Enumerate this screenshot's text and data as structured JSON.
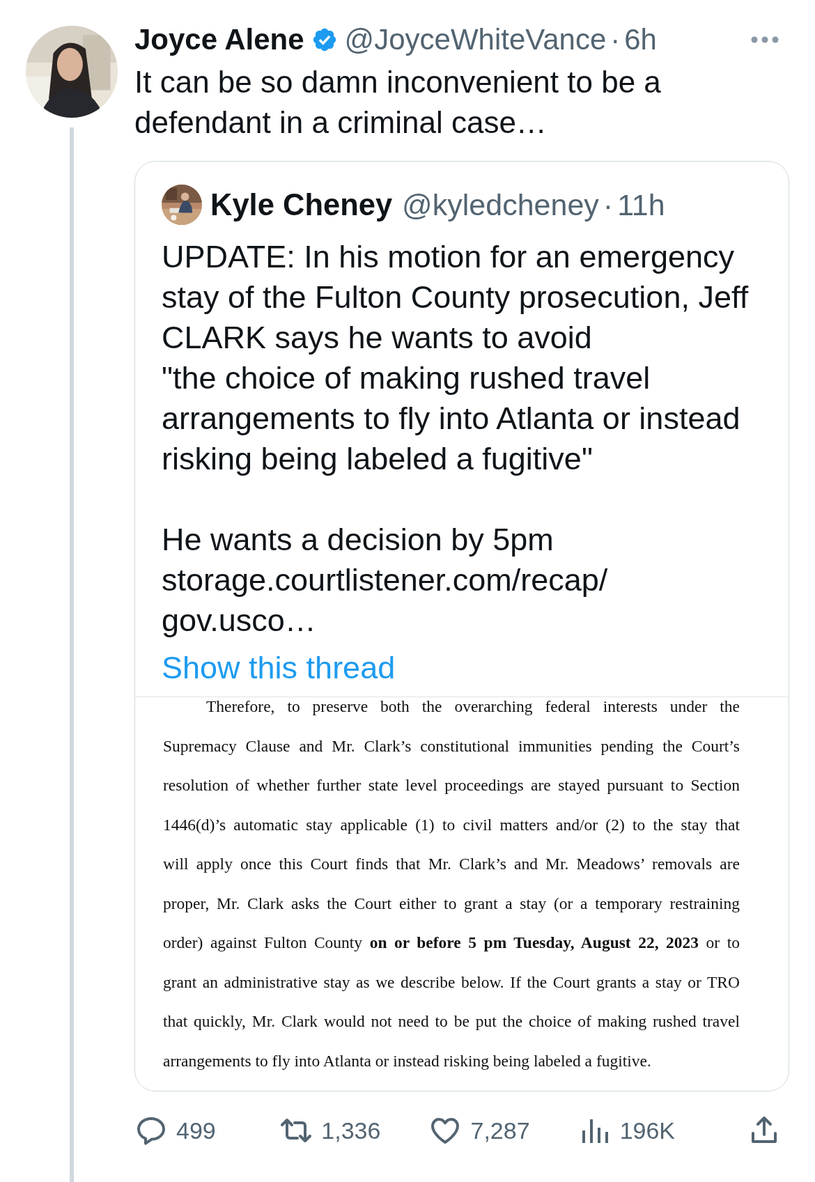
{
  "tweet": {
    "author": {
      "name": "Joyce Alene",
      "verified": true,
      "handle": "@JoyceWhiteVance",
      "separator": "·",
      "time": "6h"
    },
    "text": "It can be so damn inconvenient to be a\ndefendant in a criminal case…",
    "quote": {
      "author": {
        "name": "Kyle Cheney",
        "handle": "@kyledcheney",
        "separator": "·",
        "time": "11h"
      },
      "text": "UPDATE: In his motion for an emergency\nstay of the Fulton County prosecution, Jeff\nCLARK says he wants to avoid\n\"the choice of making rushed travel\narrangements to fly into Atlanta or instead\nrisking being labeled a fugitive\"\n\nHe wants a decision by 5pm\nstorage.courtlistener.com/recap/\ngov.usco…",
      "show_thread": "Show this thread",
      "document": {
        "lines": [
          "Therefore, to preserve both the overarching federal interests under the",
          "Supremacy Clause and Mr. Clark’s constitutional immunities pending the Court’s",
          "resolution of whether further state level proceedings are stayed pursuant to Section",
          "1446(d)’s automatic stay applicable (1) to civil matters and/or (2) to the stay that",
          "will apply once this Court finds that Mr. Clark’s and Mr. Meadows’ removals are",
          "proper, Mr. Clark asks the Court either to grant a stay (or a temporary restraining",
          "order) against Fulton County **on or before 5 pm Tuesday, August 22, 2023** or to",
          "grant an administrative stay as we describe below. If the Court grants a stay or TRO",
          "that quickly, Mr. Clark would not need to be put the choice of making rushed travel",
          "arrangements to fly into Atlanta or instead risking being labeled a fugitive."
        ]
      }
    },
    "actions": [
      {
        "kind": "reply",
        "count": "499"
      },
      {
        "kind": "retweet",
        "count": "1,336"
      },
      {
        "kind": "like",
        "count": "7,287"
      },
      {
        "kind": "views",
        "count": "196K"
      },
      {
        "kind": "share"
      }
    ]
  }
}
